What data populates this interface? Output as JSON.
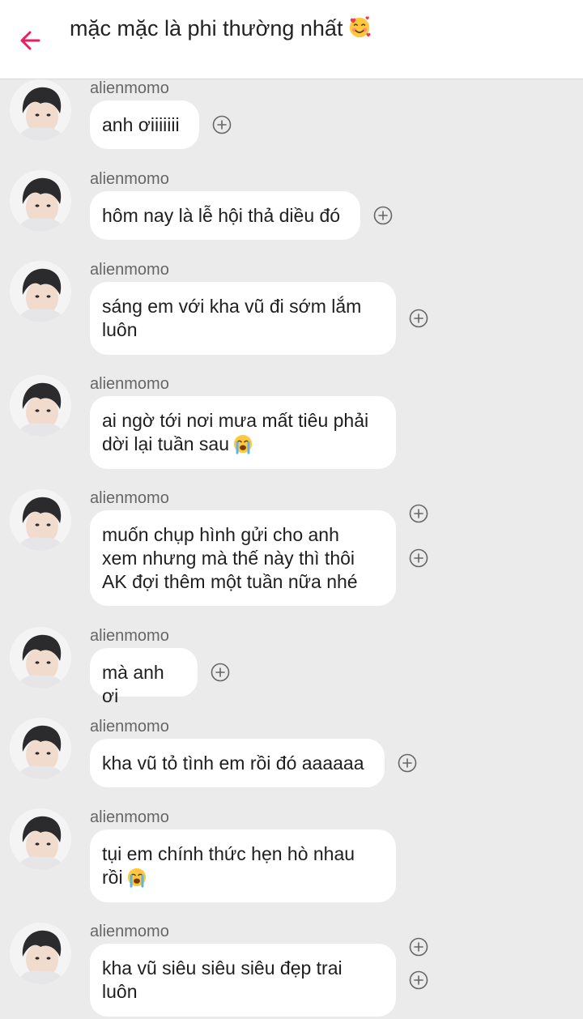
{
  "header": {
    "title": "mặc mặc là phi thường nhất",
    "title_emoji": "smiling-face-with-hearts",
    "accent_color": "#e91e63"
  },
  "messages": [
    {
      "sender": "alienmomo",
      "text": "anh ơiiiiiii",
      "emoji": ""
    },
    {
      "sender": "alienmomo",
      "text": "hôm nay là lễ hội thả diều đó",
      "emoji": ""
    },
    {
      "sender": "alienmomo",
      "text": "sáng em với kha vũ đi sớm lắm\nluôn",
      "emoji": ""
    },
    {
      "sender": "alienmomo",
      "text": "ai ngờ tới nơi mưa mất tiêu phải\ndời lại tuần sau",
      "emoji": "loudly-crying-face"
    },
    {
      "sender": "alienmomo",
      "text": "muốn chụp hình gửi cho anh\nxem nhưng mà thế này thì thôi\nAK đợi thêm một tuần nữa nhé",
      "emoji": ""
    },
    {
      "sender": "alienmomo",
      "text": "mà anh ơi",
      "emoji": ""
    },
    {
      "sender": "alienmomo",
      "text": "kha vũ tỏ tình em rồi đó aaaaaa",
      "emoji": ""
    },
    {
      "sender": "alienmomo",
      "text": "tụi em chính thức hẹn hò nhau\nrồi",
      "emoji": "loudly-crying-face"
    },
    {
      "sender": "alienmomo",
      "text": "kha vũ siêu siêu siêu đẹp trai\nluôn",
      "emoji": ""
    }
  ],
  "colors": {
    "background": "#ebebeb",
    "bubble": "#ffffff",
    "text": "#1e1e1e",
    "sender": "#666666"
  }
}
